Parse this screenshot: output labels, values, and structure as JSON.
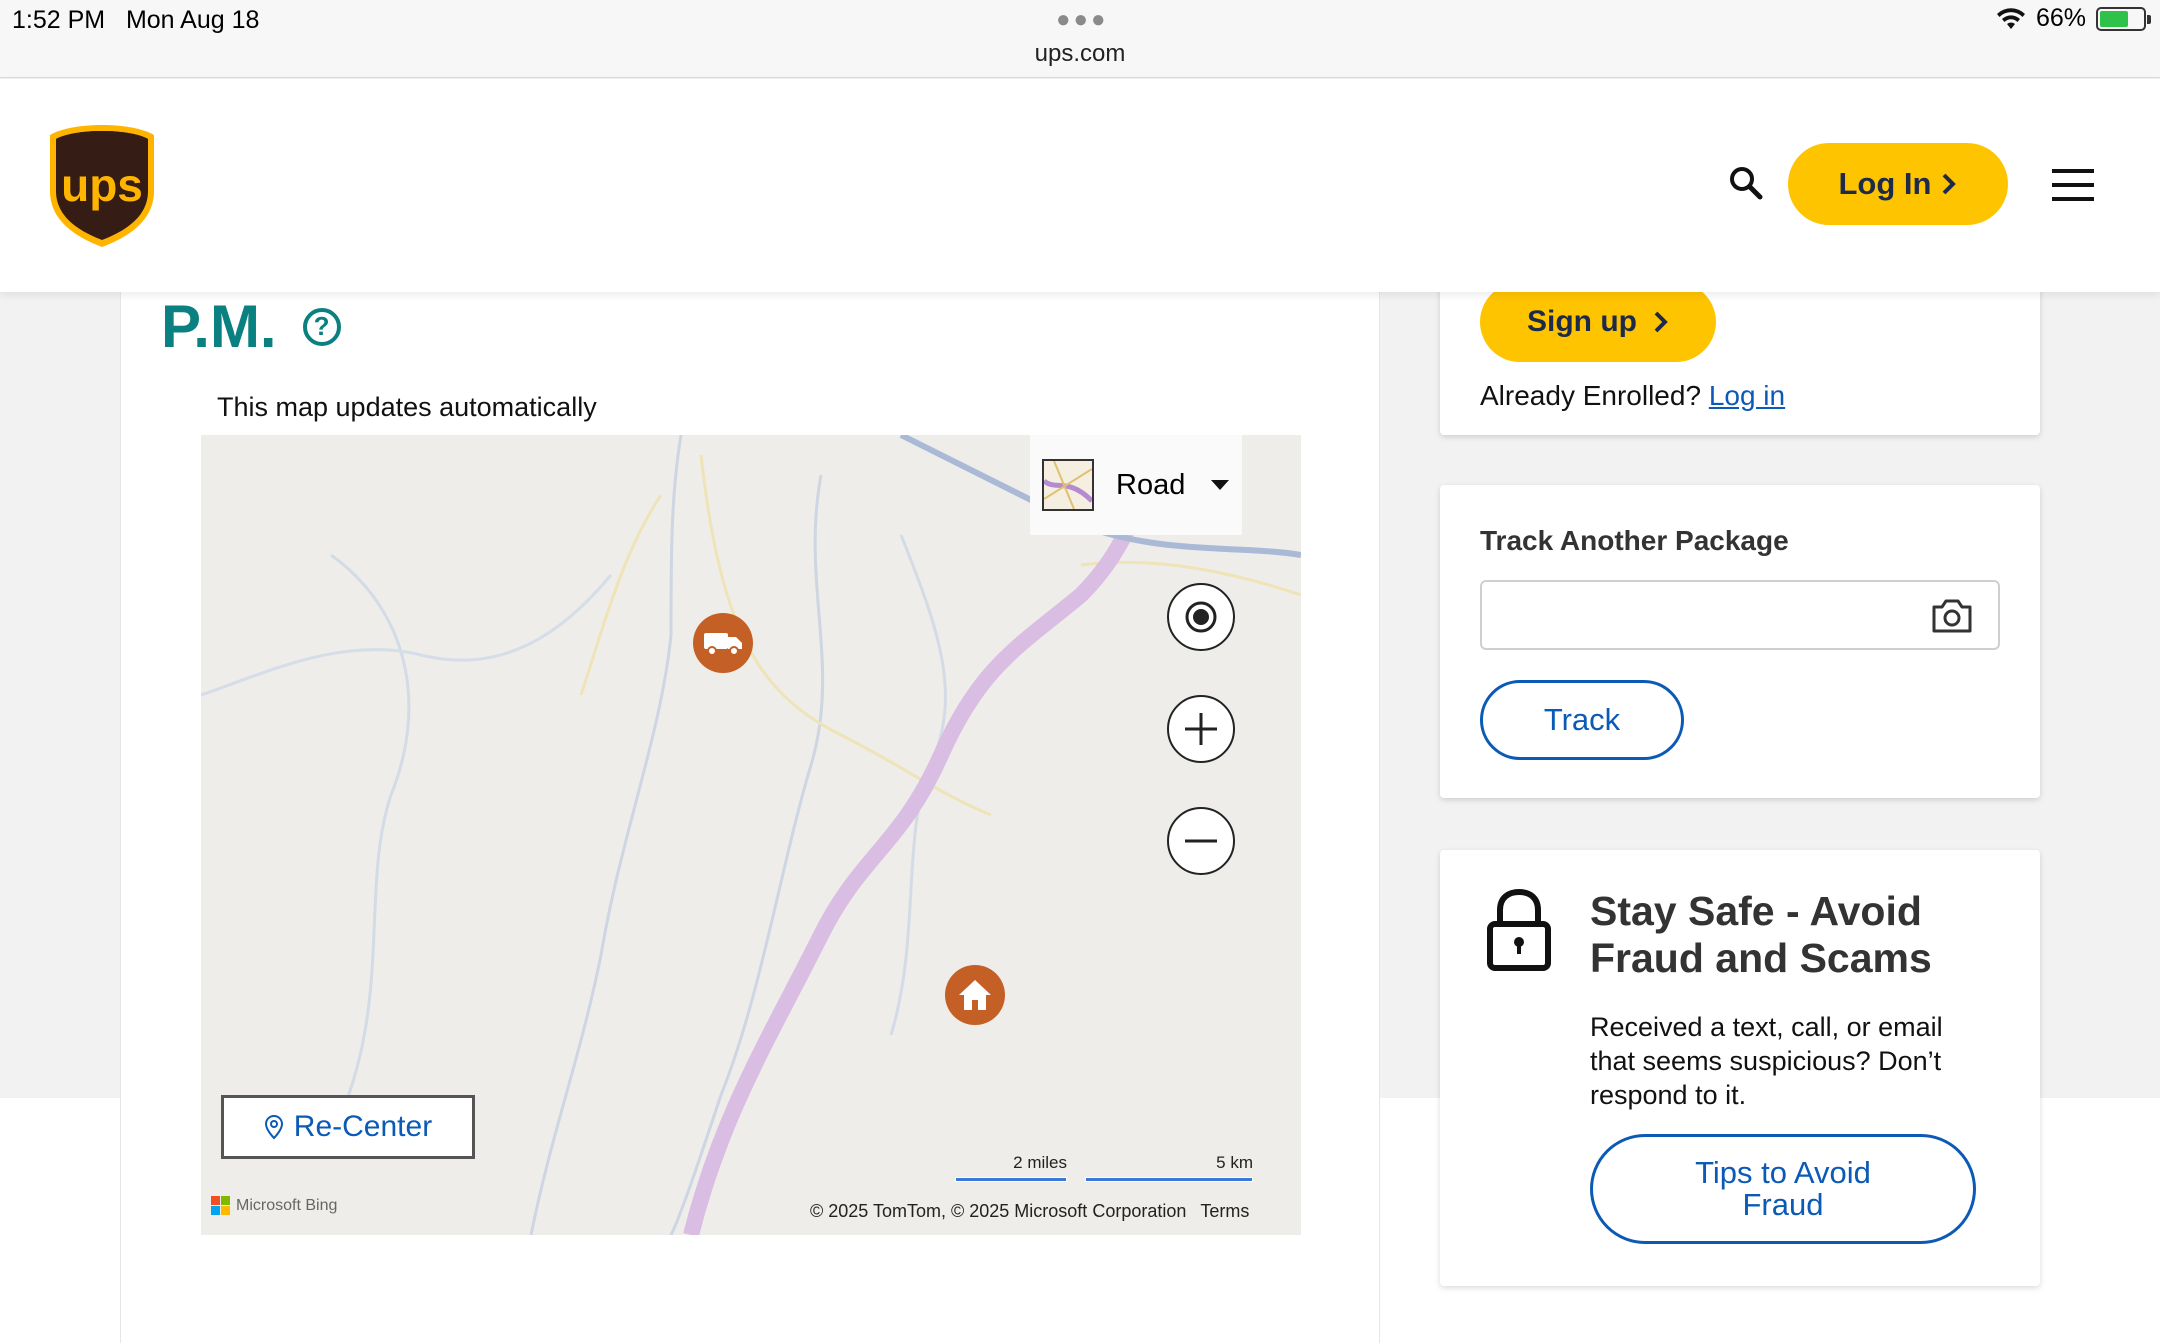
{
  "status_bar": {
    "time": "1:52 PM",
    "date": "Mon Aug 18",
    "url": "ups.com",
    "battery": "66%",
    "battery_level": 0.66
  },
  "header": {
    "logo_text": "ups",
    "login_label": "Log In"
  },
  "tracking": {
    "heading": "P.M.",
    "map_note": "This map updates automatically"
  },
  "map": {
    "layer_selected": "Road",
    "recenter_label": "Re-Center",
    "scale_miles": "2 miles",
    "scale_km": "5 km",
    "attribution_brand": "Microsoft Bing",
    "copyright": "© 2025 TomTom, © 2025 Microsoft Corporation",
    "terms": "Terms"
  },
  "signup_card": {
    "signup_label": "Sign up",
    "enrolled_text": "Already Enrolled?",
    "login_link": "Log in"
  },
  "track_card": {
    "title": "Track Another Package",
    "input_value": "",
    "input_placeholder": "",
    "track_label": "Track"
  },
  "fraud_card": {
    "title": "Stay Safe - Avoid Fraud and Scams",
    "text": "Received a text, call, or email that seems suspicious? Don’t respond to it.",
    "tips_label": "Tips to Avoid Fraud"
  },
  "colors": {
    "ups_brown": "#351c15",
    "ups_gold": "#ffc400",
    "teal": "#0a8080",
    "link_blue": "#0b5ab5",
    "pin_orange": "#c45f25"
  }
}
